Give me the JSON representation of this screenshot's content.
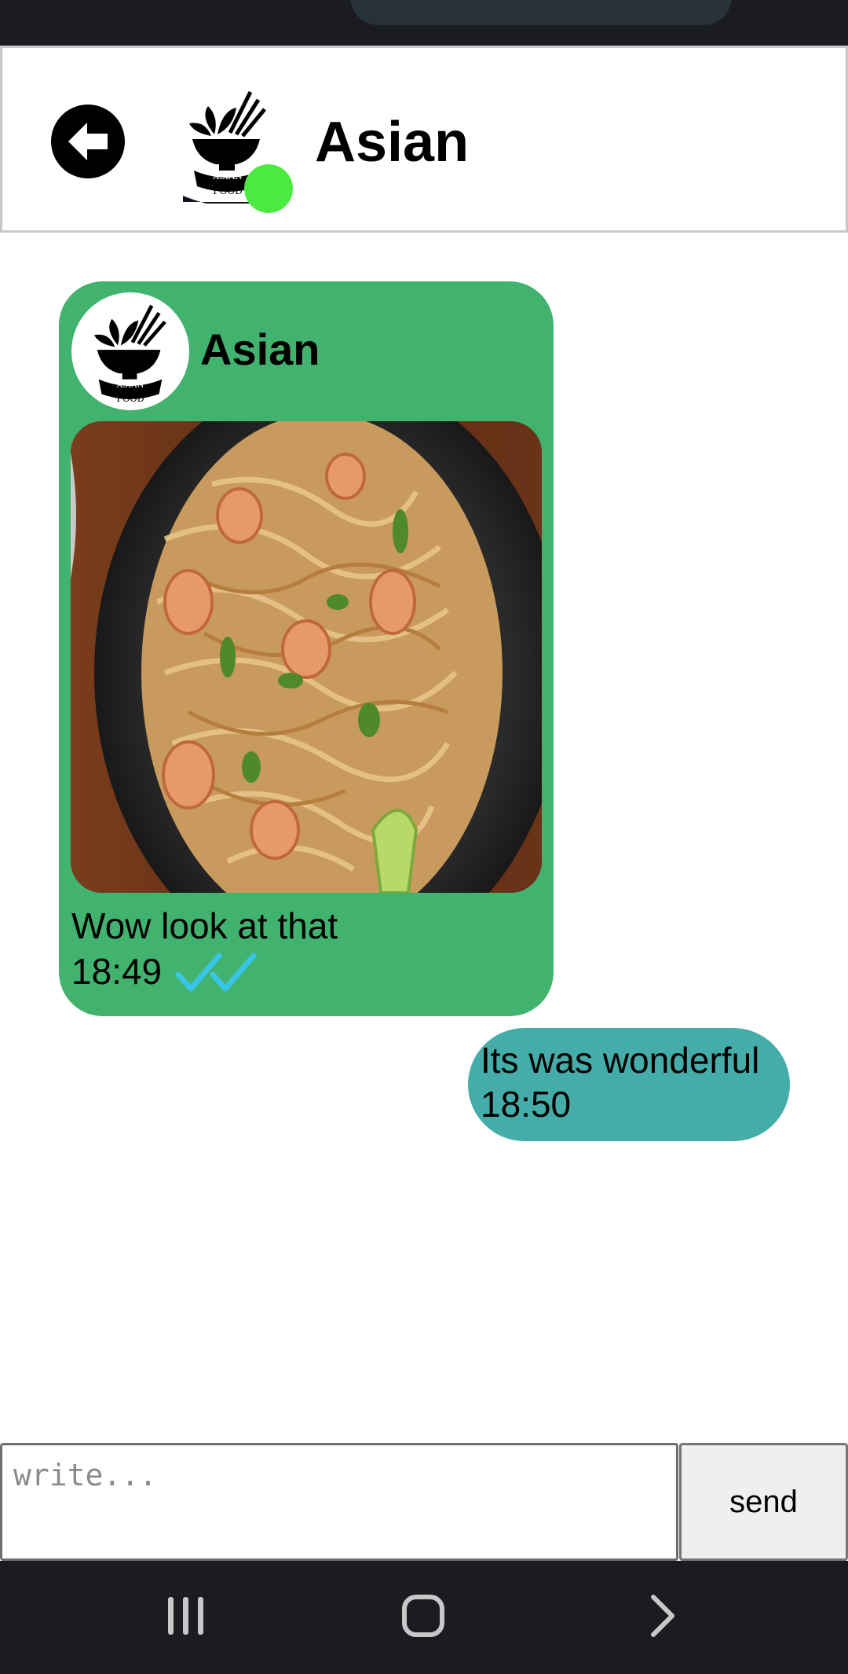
{
  "header": {
    "contact_name": "Asian",
    "online": true,
    "online_color": "#4cea40",
    "back_icon": "back-arrow-icon"
  },
  "logo": {
    "line1": "ASIAN",
    "line2": "FOOD"
  },
  "messages": [
    {
      "direction": "incoming",
      "sender": "Asian",
      "image": "noodles-with-shrimp-photo",
      "text": "Wow look at that",
      "time": "18:49",
      "status_icon": "double-check-icon",
      "bubble_color": "#42b36e"
    },
    {
      "direction": "outgoing",
      "text": "Its was wonderful",
      "time": "18:50",
      "bubble_color": "#45ada9"
    }
  ],
  "composer": {
    "placeholder": "write...",
    "value": "",
    "send_label": "send"
  },
  "navbar": {
    "recents_icon": "recents-icon",
    "home_icon": "home-icon",
    "back_icon": "chevron-right-icon"
  }
}
